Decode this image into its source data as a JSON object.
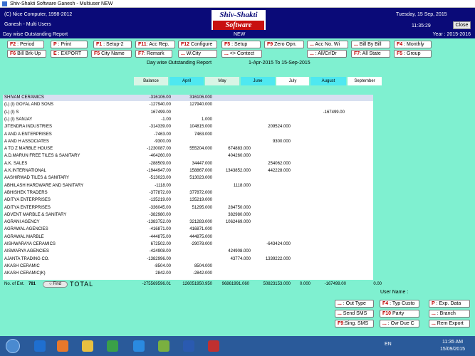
{
  "window": {
    "title": "Shiv-Shakti Software    Ganesh - Multiuser  NEW"
  },
  "header": {
    "copyright": "(C) Nice Computer, 1998-2012",
    "users": "Ganesh - Multi Users",
    "logo_top": "Shiv-Shakti",
    "logo_bottom": "Software",
    "date": "Tuesday, 15 Sep, 2015",
    "time": "11:35:29",
    "close_label": "Close"
  },
  "subbar": {
    "report": "Day wise Outstanding Report",
    "mode": "NEW",
    "year": "Year : 2015-2016"
  },
  "fkeys_row1": [
    {
      "k": "F2",
      "t": " : Period"
    },
    {
      "k": "P",
      "t": " : Print"
    },
    {
      "k": "F1",
      "t": " : Setup-2"
    },
    {
      "k": "F11",
      "t": ": Acc Rep."
    },
    {
      "k": "F12",
      "t": " Configure"
    },
    {
      "k": "F5",
      "t": " : Setup"
    },
    {
      "k": "F9",
      "t": " Zero Opn."
    },
    {
      "k": "...",
      "t": " Acc No. Wi"
    },
    {
      "k": "...",
      "t": " Bill By Bill"
    },
    {
      "k": "F4",
      "t": " : Monthly"
    }
  ],
  "fkeys_row2": [
    {
      "k": "F6",
      "t": " Bill Brk-Up"
    },
    {
      "k": "E",
      "t": " : EXPORT"
    },
    {
      "k": "F5",
      "t": " City Name"
    },
    {
      "k": "F7",
      "t": ": Remark"
    },
    {
      "k": "...",
      "t": " W.City"
    },
    {
      "k": "...",
      "t": " <> Contect"
    },
    {
      "k": "...",
      "t": " : All/Cr/Dr"
    },
    {
      "k": "F7",
      "t": ": All State"
    },
    {
      "k": "F5",
      "t": " : Group"
    }
  ],
  "report": {
    "title": "Day wise Outstanding Report",
    "range": "1-Apr-2015 To 15-Sep-2015"
  },
  "columns": [
    "Balance",
    "April",
    "May",
    "June",
    "July",
    "August",
    "September"
  ],
  "column_colors": [
    "#d9f5e6",
    "#4fe8f0",
    "#d9f5e6",
    "#4fe8f0",
    "#ffffff",
    "#4fe8f0",
    "#ffffff"
  ],
  "rows": [
    {
      "name": "SHIVAM CERAMICS",
      "bal": "-316106.00",
      "apr": "316106.000",
      "may": "",
      "jun": "",
      "jul": "",
      "aug": "",
      "sep": ""
    },
    {
      "name": "(L) (I) GOYAL AND SONS",
      "bal": "-127940.00",
      "apr": "127940.000",
      "may": "",
      "jun": "",
      "jul": "",
      "aug": "",
      "sep": ""
    },
    {
      "name": "(L) (I) S",
      "bal": "167499.00",
      "apr": "",
      "may": "",
      "jun": "",
      "jul": "",
      "aug": "-167499.00",
      "sep": ""
    },
    {
      "name": "(L) (I) SANJAY",
      "bal": "-1.00",
      "apr": "1.000",
      "may": "",
      "jun": "",
      "jul": "",
      "aug": "",
      "sep": ""
    },
    {
      "name": "JITENDRA INDUSTRIES",
      "bal": "-314339.00",
      "apr": "104815.000",
      "may": "",
      "jun": "209524.000",
      "jul": "",
      "aug": "",
      "sep": ""
    },
    {
      "name": "A AND A ENTERPRISES",
      "bal": "-7463.00",
      "apr": "7463.000",
      "may": "",
      "jun": "",
      "jul": "",
      "aug": "",
      "sep": ""
    },
    {
      "name": "A AND H ASSOCIATES",
      "bal": "-9300.00",
      "apr": "",
      "may": "",
      "jun": "9300.000",
      "jul": "",
      "aug": "",
      "sep": ""
    },
    {
      "name": "A TO Z MARBLE HOUSE",
      "bal": "-1230087.00",
      "apr": "555204.000",
      "may": "674883.000",
      "jun": "",
      "jul": "",
      "aug": "",
      "sep": ""
    },
    {
      "name": "A.D.MARUN FREE TILES & SANITARY",
      "bal": "-404260.00",
      "apr": "",
      "may": "404260.000",
      "jun": "",
      "jul": "",
      "aug": "",
      "sep": ""
    },
    {
      "name": "A.K. SALES",
      "bal": "-288509.00",
      "apr": "34447.000",
      "may": "",
      "jun": "254062.000",
      "jul": "",
      "aug": "",
      "sep": ""
    },
    {
      "name": "A.K.INTERNATIONAL",
      "bal": "-1944947.00",
      "apr": "158867.000",
      "may": "1343852.000",
      "jun": "442228.000",
      "jul": "",
      "aug": "",
      "sep": ""
    },
    {
      "name": "AASHIRWAD TILES & SANITARY",
      "bal": "-513023.00",
      "apr": "513023.000",
      "may": "",
      "jun": "",
      "jul": "",
      "aug": "",
      "sep": ""
    },
    {
      "name": "ABHILASH HARDWARE AND SANITARY",
      "bal": "-1118.00",
      "apr": "",
      "may": "1118.000",
      "jun": "",
      "jul": "",
      "aug": "",
      "sep": ""
    },
    {
      "name": "ABHISHEK TRADERS",
      "bal": "-377872.00",
      "apr": "377872.000",
      "may": "",
      "jun": "",
      "jul": "",
      "aug": "",
      "sep": ""
    },
    {
      "name": "ADITYA ENTERPRISES",
      "bal": "-135219.00",
      "apr": "135219.000",
      "may": "",
      "jun": "",
      "jul": "",
      "aug": "",
      "sep": ""
    },
    {
      "name": "ADITYA ENTERPRISES",
      "bal": "-336045.00",
      "apr": "51295.000",
      "may": "284750.000",
      "jun": "",
      "jul": "",
      "aug": "",
      "sep": ""
    },
    {
      "name": "ADVENT MARBLE & SANITARY",
      "bal": "-382980.00",
      "apr": "",
      "may": "382980.000",
      "jun": "",
      "jul": "",
      "aug": "",
      "sep": ""
    },
    {
      "name": "AGRANI AGENCY",
      "bal": "-1383752.00",
      "apr": "321283.000",
      "may": "1062469.000",
      "jun": "",
      "jul": "",
      "aug": "",
      "sep": ""
    },
    {
      "name": "AGRAWAL AGENCIES",
      "bal": "-416871.00",
      "apr": "416871.000",
      "may": "",
      "jun": "",
      "jul": "",
      "aug": "",
      "sep": ""
    },
    {
      "name": "AGRAWAL MARBLE",
      "bal": "-444875.00",
      "apr": "444875.000",
      "may": "",
      "jun": "",
      "jul": "",
      "aug": "",
      "sep": ""
    },
    {
      "name": "AISHWARAYA CERAMICS",
      "bal": "672502.00",
      "apr": "-29078.000",
      "may": "",
      "jun": "-643424.000",
      "jul": "",
      "aug": "",
      "sep": ""
    },
    {
      "name": "AISWARYA AGENCIES",
      "bal": "-424908.00",
      "apr": "",
      "may": "424908.000",
      "jun": "",
      "jul": "",
      "aug": "",
      "sep": ""
    },
    {
      "name": "AJANTA TRADING CO.",
      "bal": "-1382996.00",
      "apr": "",
      "may": "43774.000",
      "jun": "1339222.000",
      "jul": "",
      "aug": "",
      "sep": ""
    },
    {
      "name": "AKASH CERAMIC",
      "bal": "-8504.00",
      "apr": "8504.000",
      "may": "",
      "jun": "",
      "jul": "",
      "aug": "",
      "sep": ""
    },
    {
      "name": "AKASH CERAMIC(K)",
      "bal": "2842.00",
      "apr": "-2842.000",
      "may": "",
      "jun": "",
      "jul": "",
      "aug": "",
      "sep": ""
    }
  ],
  "totals": {
    "entries_label": "No. of Ent.",
    "entries": "781",
    "find": "Find",
    "label": "TOTAL",
    "bal": "-275569596.01",
    "apr": "126051950.950",
    "may": "96861991.060",
    "jun": "50823153.000",
    "jul": "0.000",
    "aug": "-167499.00",
    "sep": "0.00"
  },
  "user_name_label": "User Name :",
  "right_buttons": [
    {
      "k": "...",
      "t": " : Out Type"
    },
    {
      "k": "F4",
      "t": " : Typ Custo"
    },
    {
      "k": "P",
      "t": " : Exp. Data"
    },
    {
      "k": "...",
      "t": " Send SMS"
    },
    {
      "k": "F10",
      "t": " Party"
    },
    {
      "k": "...",
      "t": " : Branch"
    },
    {
      "k": "F9",
      "t": ":Sing. SMS"
    },
    {
      "k": "...",
      "t": " : Ovr Due C"
    },
    {
      "k": "...",
      "t": " Rem Export"
    }
  ],
  "taskbar": {
    "lang": "EN",
    "time": "11:35 AM",
    "date": "15/09/2015"
  }
}
